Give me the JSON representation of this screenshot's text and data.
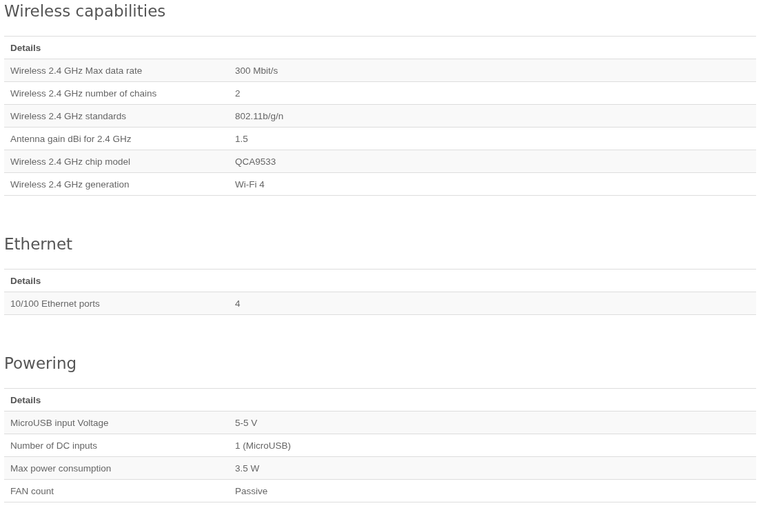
{
  "sections": [
    {
      "title": "Wireless capabilities",
      "header": "Details",
      "rows": [
        {
          "label": "Wireless 2.4 GHz Max data rate",
          "value": "300 Mbit/s"
        },
        {
          "label": "Wireless 2.4 GHz number of chains",
          "value": "2"
        },
        {
          "label": "Wireless 2.4 GHz standards",
          "value": "802.11b/g/n"
        },
        {
          "label": "Antenna gain dBi for 2.4 GHz",
          "value": "1.5"
        },
        {
          "label": "Wireless 2.4 GHz chip model",
          "value": "QCA9533"
        },
        {
          "label": "Wireless 2.4 GHz generation",
          "value": "Wi-Fi 4"
        }
      ]
    },
    {
      "title": "Ethernet",
      "header": "Details",
      "rows": [
        {
          "label": "10/100 Ethernet ports",
          "value": "4"
        }
      ]
    },
    {
      "title": "Powering",
      "header": "Details",
      "rows": [
        {
          "label": "MicroUSB input Voltage",
          "value": "5-5 V"
        },
        {
          "label": "Number of DC inputs",
          "value": "1 (MicroUSB)"
        },
        {
          "label": "Max power consumption",
          "value": "3.5 W"
        },
        {
          "label": "FAN count",
          "value": "Passive"
        }
      ]
    }
  ]
}
